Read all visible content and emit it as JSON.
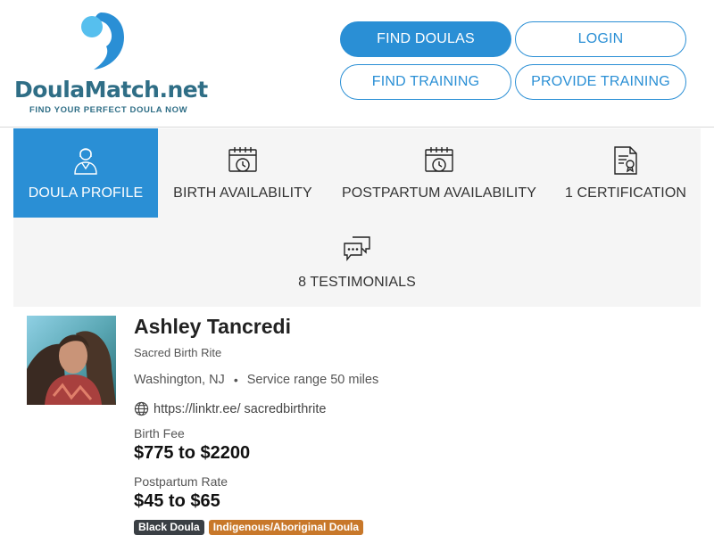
{
  "brand": {
    "name_main": "DoulaMatch",
    "name_suffix": ".net",
    "tagline": "FIND YOUR PERFECT DOULA NOW",
    "colors": {
      "mark_dark": "#2a8fd5",
      "mark_light": "#56bfee",
      "text": "#2f6e86"
    }
  },
  "nav": {
    "find_doulas": "FIND DOULAS",
    "login": "LOGIN",
    "find_training": "FIND TRAINING",
    "provide_training": "PROVIDE TRAINING"
  },
  "tabs": {
    "profile": {
      "label": "DOULA PROFILE",
      "icon": "person-icon",
      "active": true
    },
    "birth": {
      "label": "BIRTH AVAILABILITY",
      "icon": "calendar-clock-icon"
    },
    "postpartum": {
      "label": "POSTPARTUM AVAILABILITY",
      "icon": "calendar-clock-icon"
    },
    "certification": {
      "label": "1 CERTIFICATION",
      "icon": "certificate-icon"
    },
    "testimonials": {
      "label": "8 TESTIMONIALS",
      "icon": "chat-bubbles-icon"
    }
  },
  "profile": {
    "name": "Ashley Tancredi",
    "business": "Sacred Birth Rite",
    "location": "Washington, NJ",
    "separator": "•",
    "service_range": "Service range 50 miles",
    "website": "https://linktr.ee/ sacredbirthrite",
    "birth_fee_label": "Birth Fee",
    "birth_fee": "$775 to $2200",
    "postpartum_label": "Postpartum Rate",
    "postpartum_rate": "$45 to $65",
    "badges": [
      {
        "label": "Black Doula",
        "color": "#3a3f44"
      },
      {
        "label": "Indigenous/Aboriginal Doula",
        "color": "#c8782a"
      }
    ]
  },
  "colors": {
    "accent": "#2a8fd5",
    "tab_bg": "#f5f5f5"
  }
}
